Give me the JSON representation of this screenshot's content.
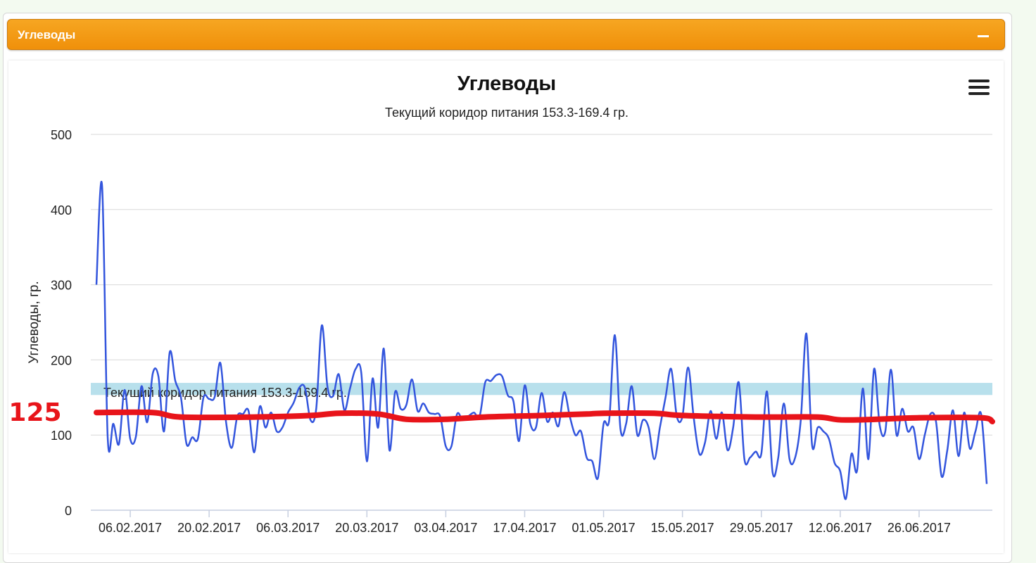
{
  "panel": {
    "title": "Углеводы"
  },
  "icons": {
    "collapse": "minus-icon",
    "menu": "hamburger-menu-icon"
  },
  "colors": {
    "series": "#3355dd",
    "band": "#b8e0ec",
    "trend": "#e8141a",
    "header": "#f39a12"
  },
  "chart_data": {
    "type": "line",
    "title": "Углеводы",
    "subtitle": "Текущий коридор питания 153.3-169.4 гр.",
    "ylabel": "Углеводы, гр.",
    "xlabel": "",
    "ylim": [
      0,
      500
    ],
    "yticks": [
      0,
      100,
      200,
      300,
      400,
      500
    ],
    "xlim": [
      "2017-01-30",
      "2017-07-09"
    ],
    "xticks": [
      "06.02.2017",
      "20.02.2017",
      "06.03.2017",
      "20.03.2017",
      "03.04.2017",
      "17.04.2017",
      "01.05.2017",
      "15.05.2017",
      "29.05.2017",
      "12.06.2017",
      "26.06.2017"
    ],
    "grid": true,
    "legend": "none",
    "plot_band": {
      "from": 153.3,
      "to": 169.4,
      "label": "Текущий коридор питания 153.3-169.4 гр."
    },
    "series": [
      {
        "x": [
          "2017-01-31",
          "2017-02-01",
          "2017-02-02",
          "2017-02-03",
          "2017-02-04",
          "2017-02-05",
          "2017-02-06",
          "2017-02-07",
          "2017-02-08",
          "2017-02-09",
          "2017-02-10",
          "2017-02-11",
          "2017-02-12",
          "2017-02-13",
          "2017-02-14",
          "2017-02-15",
          "2017-02-16",
          "2017-02-17",
          "2017-02-18",
          "2017-02-19",
          "2017-02-20",
          "2017-02-21",
          "2017-02-22",
          "2017-02-23",
          "2017-02-24",
          "2017-02-25",
          "2017-02-26",
          "2017-02-27",
          "2017-02-28",
          "2017-03-01",
          "2017-03-02",
          "2017-03-03",
          "2017-03-04",
          "2017-03-05",
          "2017-03-06",
          "2017-03-07",
          "2017-03-08",
          "2017-03-09",
          "2017-03-10",
          "2017-03-11",
          "2017-03-12",
          "2017-03-13",
          "2017-03-14",
          "2017-03-15",
          "2017-03-16",
          "2017-03-17",
          "2017-03-18",
          "2017-03-19",
          "2017-03-20",
          "2017-03-21",
          "2017-03-22",
          "2017-03-23",
          "2017-03-24",
          "2017-03-25",
          "2017-03-26",
          "2017-03-27",
          "2017-03-28",
          "2017-03-29",
          "2017-03-30",
          "2017-03-31",
          "2017-04-01",
          "2017-04-02",
          "2017-04-03",
          "2017-04-04",
          "2017-04-05",
          "2017-04-06",
          "2017-04-07",
          "2017-04-08",
          "2017-04-09",
          "2017-04-10",
          "2017-04-11",
          "2017-04-12",
          "2017-04-13",
          "2017-04-14",
          "2017-04-15",
          "2017-04-16",
          "2017-04-17",
          "2017-04-18",
          "2017-04-19",
          "2017-04-20",
          "2017-04-21",
          "2017-04-22",
          "2017-04-23",
          "2017-04-24",
          "2017-04-25",
          "2017-04-26",
          "2017-04-27",
          "2017-04-28",
          "2017-04-29",
          "2017-04-30",
          "2017-05-01",
          "2017-05-02",
          "2017-05-03",
          "2017-05-04",
          "2017-05-05",
          "2017-05-06",
          "2017-05-07",
          "2017-05-08",
          "2017-05-09",
          "2017-05-10",
          "2017-05-11",
          "2017-05-12",
          "2017-05-13",
          "2017-05-14",
          "2017-05-15",
          "2017-05-16",
          "2017-05-17",
          "2017-05-18",
          "2017-05-19",
          "2017-05-20",
          "2017-05-21",
          "2017-05-22",
          "2017-05-23",
          "2017-05-24",
          "2017-05-25",
          "2017-05-26",
          "2017-05-27",
          "2017-05-28",
          "2017-05-29",
          "2017-05-30",
          "2017-05-31",
          "2017-06-01",
          "2017-06-02",
          "2017-06-03",
          "2017-06-04",
          "2017-06-05",
          "2017-06-06",
          "2017-06-07",
          "2017-06-08",
          "2017-06-09",
          "2017-06-10",
          "2017-06-11",
          "2017-06-12",
          "2017-06-13",
          "2017-06-14",
          "2017-06-15",
          "2017-06-16",
          "2017-06-17",
          "2017-06-18",
          "2017-06-19",
          "2017-06-20",
          "2017-06-21",
          "2017-06-22",
          "2017-06-23",
          "2017-06-24",
          "2017-06-25",
          "2017-06-26",
          "2017-06-27",
          "2017-06-28",
          "2017-06-29",
          "2017-06-30",
          "2017-07-01",
          "2017-07-02",
          "2017-07-03",
          "2017-07-04",
          "2017-07-05",
          "2017-07-06",
          "2017-07-07",
          "2017-07-08"
        ],
        "values": [
          300,
          432,
          97,
          115,
          88,
          160,
          95,
          98,
          165,
          117,
          182,
          178,
          105,
          210,
          172,
          150,
          88,
          97,
          95,
          150,
          148,
          151,
          196,
          118,
          83,
          125,
          128,
          132,
          77,
          138,
          110,
          130,
          105,
          110,
          130,
          143,
          163,
          163,
          120,
          135,
          246,
          164,
          152,
          181,
          133,
          162,
          188,
          183,
          65,
          175,
          110,
          215,
          80,
          157,
          135,
          140,
          174,
          132,
          142,
          130,
          128,
          125,
          85,
          85,
          128,
          120,
          125,
          130,
          125,
          170,
          172,
          180,
          178,
          153,
          145,
          92,
          166,
          115,
          110,
          156,
          118,
          130,
          112,
          157,
          125,
          100,
          105,
          70,
          65,
          43,
          115,
          120,
          233,
          108,
          115,
          165,
          100,
          120,
          110,
          68,
          110,
          150,
          188,
          125,
          125,
          190,
          123,
          75,
          90,
          132,
          95,
          130,
          80,
          110,
          170,
          68,
          70,
          78,
          75,
          158,
          50,
          70,
          142,
          68,
          70,
          120,
          235,
          87,
          110,
          105,
          95,
          63,
          52,
          15,
          75,
          53,
          162,
          68,
          188,
          113,
          105,
          187,
          100,
          135,
          105,
          110,
          68,
          100,
          128,
          118,
          45,
          80,
          133,
          72,
          130,
          82,
          105,
          128,
          35
        ]
      }
    ],
    "annotation": {
      "label": "125",
      "trend": [
        [
          "2017-01-31",
          130
        ],
        [
          "2017-02-10",
          130
        ],
        [
          "2017-02-15",
          124
        ],
        [
          "2017-02-28",
          124
        ],
        [
          "2017-03-10",
          126
        ],
        [
          "2017-03-15",
          129
        ],
        [
          "2017-03-22",
          128
        ],
        [
          "2017-03-27",
          121
        ],
        [
          "2017-04-03",
          121
        ],
        [
          "2017-04-10",
          124
        ],
        [
          "2017-04-20",
          126
        ],
        [
          "2017-04-28",
          128
        ],
        [
          "2017-05-01",
          129
        ],
        [
          "2017-05-10",
          129
        ],
        [
          "2017-05-15",
          126
        ],
        [
          "2017-05-28",
          124
        ],
        [
          "2017-06-08",
          124
        ],
        [
          "2017-06-13",
          120
        ],
        [
          "2017-06-26",
          123
        ],
        [
          "2017-07-07",
          123
        ],
        [
          "2017-07-09",
          118
        ]
      ]
    }
  }
}
